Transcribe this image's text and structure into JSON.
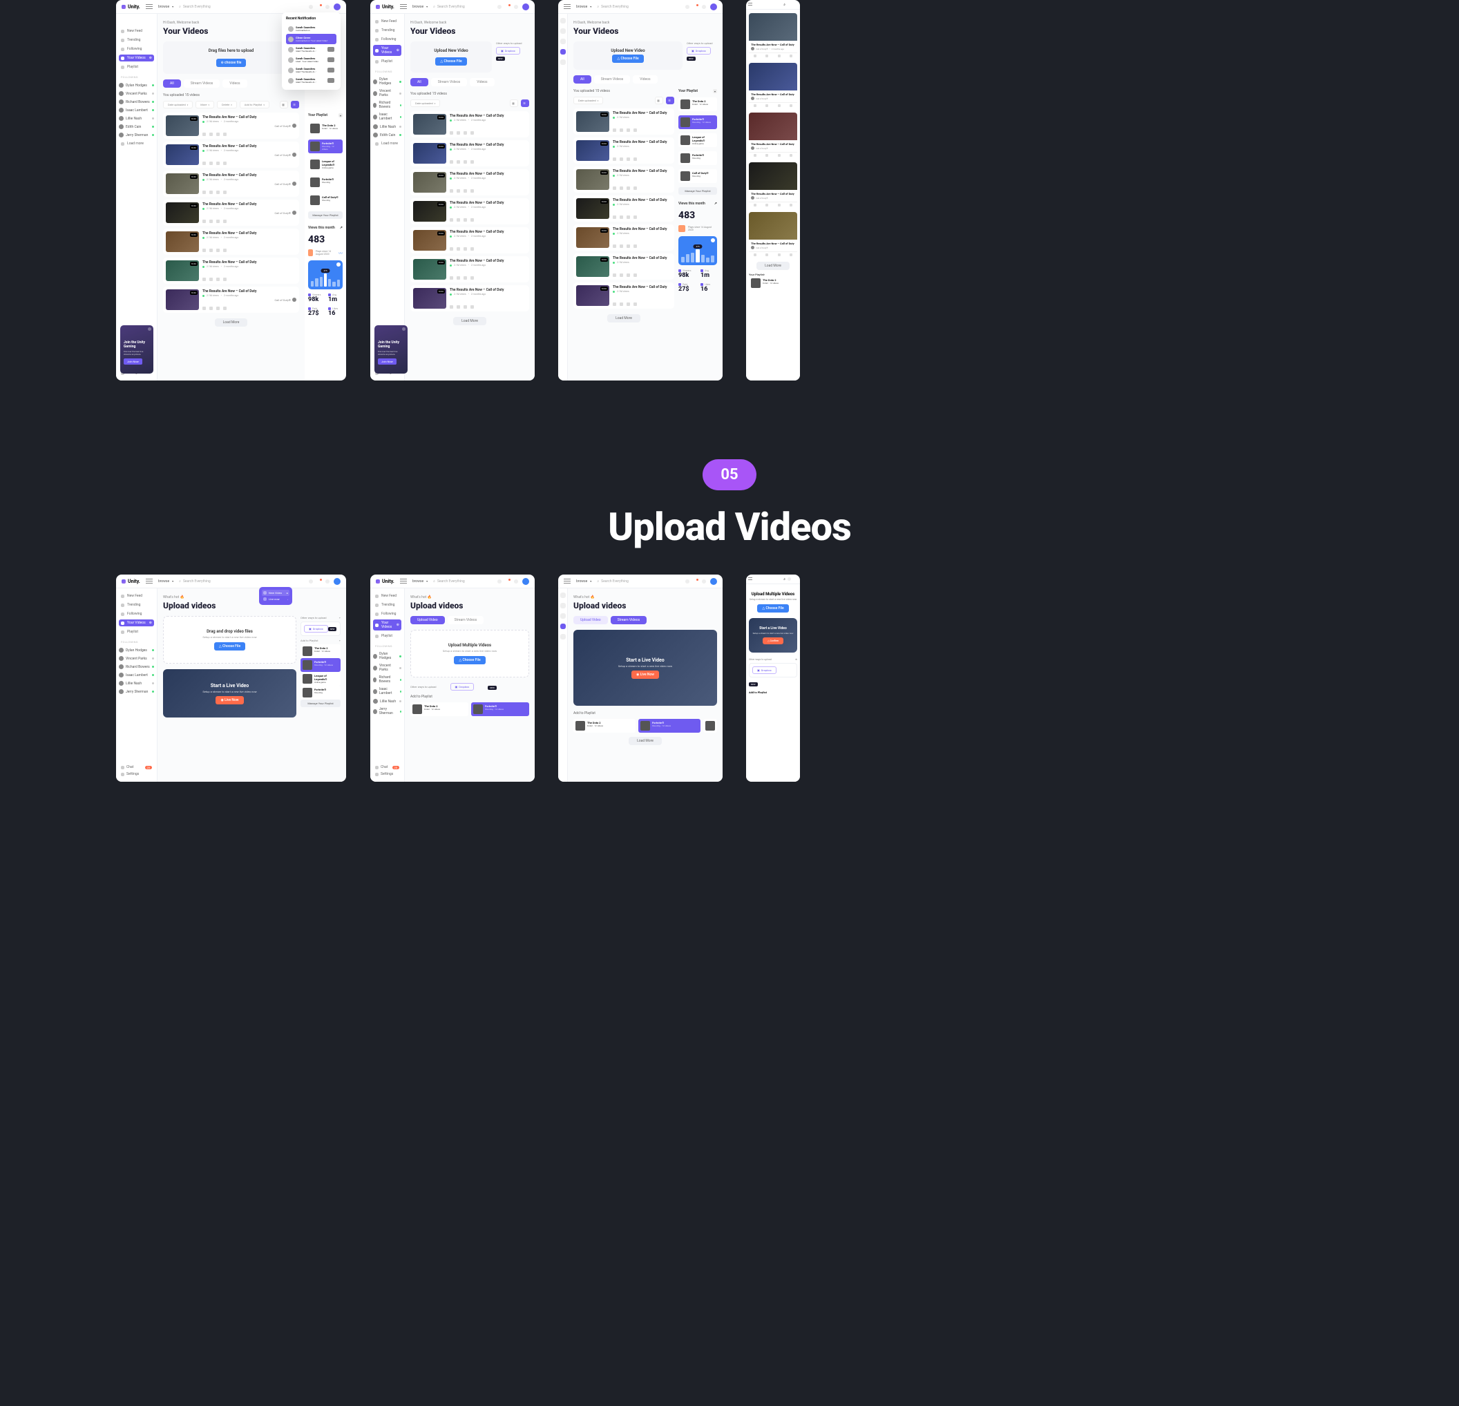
{
  "brand": "Unity.",
  "browse": "browse",
  "search_placeholder": "Search Everything",
  "greeting": "Hi Dash, Welcome back",
  "page_title_videos": "Your Videos",
  "hot_label": "What's hot 🔥",
  "page_title_upload": "Upload videos",
  "page_title_upload_mobile": "Upload Multiple Videos",
  "nav": {
    "feed": "New Feed",
    "trending": "Trending",
    "following": "Following",
    "your_videos": "Your Videos",
    "playlist": "Playlist",
    "load_more": "Load more",
    "chat": "Chat",
    "settings": "Settings",
    "following_head": "Following",
    "gaming_head": "Unity Gaming"
  },
  "followers": [
    {
      "name": "Dylan Hodges",
      "online": true
    },
    {
      "name": "Vincent Parks",
      "online": false
    },
    {
      "name": "Richard Bowers",
      "online": true
    },
    {
      "name": "Isaac Lambert",
      "online": true
    },
    {
      "name": "Lillie Nash",
      "online": false
    },
    {
      "name": "Edith Cain",
      "online": true
    },
    {
      "name": "Jerry Sherman",
      "online": true
    }
  ],
  "chat_badge": "20",
  "drag_box": {
    "title": "Drag files here to upload",
    "choose": "⊕ choose file"
  },
  "upload_new": {
    "title": "Upload New Video",
    "choose": "△ Choose File"
  },
  "drag_drop": {
    "title": "Drag and drop video files",
    "sub": "Setup a stream to start a new live video now",
    "choose": "△ Choose File"
  },
  "upload_multi": {
    "title": "Upload Multiple Videos",
    "sub": "Setup a stream to start a new live video now",
    "choose": "△ Choose File"
  },
  "other_ways": "Other ways to upload",
  "dropbox": "Dropbox",
  "new_label": "NEW",
  "tabs": {
    "all": "All",
    "stream": "Stream Videos",
    "videos": "Videos",
    "upload": "Upload Video",
    "stream2": "Stream Videos"
  },
  "uploaded_count": "You uploaded 15 videos",
  "filters": {
    "date": "Date uploaded",
    "more": "More",
    "delete": "Delete",
    "add": "Add to Playlist"
  },
  "video": {
    "title": "The Results Are Now – Call of Duty",
    "views": "2.1M views",
    "ago": "2 months ago",
    "dur": "10:42",
    "category": "Call of Duty®"
  },
  "load_more": "Load More",
  "notif": {
    "title": "Recent Notification",
    "items": [
      {
        "name": "Sarah Saunders",
        "text": "Commented on",
        "extra": ""
      },
      {
        "name": "Glenn Greer",
        "text": "Commented on",
        "extra": "\"Your Latest Video\"",
        "hl": true
      },
      {
        "name": "Sarah Saunders",
        "text": "rated 'The Results Ar…'"
      },
      {
        "name": "Sarah Saunders",
        "text": "Liked · Your Latest Video"
      },
      {
        "name": "Sarah Saunders",
        "text": "rated 'The Results Ar…'"
      },
      {
        "name": "Sarah Saunders",
        "text": "rated 'The Results Ar…'"
      }
    ]
  },
  "playlist": {
    "head": "Your Playlist",
    "items": [
      {
        "name": "The Dota 2",
        "meta": "Dota2 · 12 videos"
      },
      {
        "name": "Fortnite®",
        "meta": "Shooting · 12 videos",
        "hl": true
      },
      {
        "name": "League of Legends®",
        "meta": "Online game"
      },
      {
        "name": "Fortnite®",
        "meta": "Shooting"
      },
      {
        "name": "Call of Duty®",
        "meta": "Shooting"
      }
    ],
    "manage": "Manage Your Playlist"
  },
  "add_playlist": {
    "head": "Add to Playlist"
  },
  "views_month": {
    "head": "Views this month",
    "big": "483",
    "mini": "Plays since 14 August 2020",
    "pill": "475",
    "viewers_lbl": "Viewers",
    "viewers": "98k",
    "avg_lbl": "Avg",
    "avg": "1m",
    "paid_lbl": "Paid",
    "paid": "27$",
    "likes_lbl": "Likes",
    "likes": "16"
  },
  "promo": {
    "title": "Join the Unity Gaming",
    "sub": "Discover the best live streams anywhere.",
    "btn": "Join Now"
  },
  "live": {
    "title": "Start a Live Video",
    "sub": "Setup a stream to start a new live video now",
    "btn": "◉ Live Now",
    "confirm": "△ Confirm"
  },
  "upl_popup": {
    "opt1": "New Video",
    "opt2": "Live now"
  },
  "divider": {
    "num": "05",
    "title": "Upload Videos"
  },
  "setup_sub": "Setup a stream to start a new live video now"
}
